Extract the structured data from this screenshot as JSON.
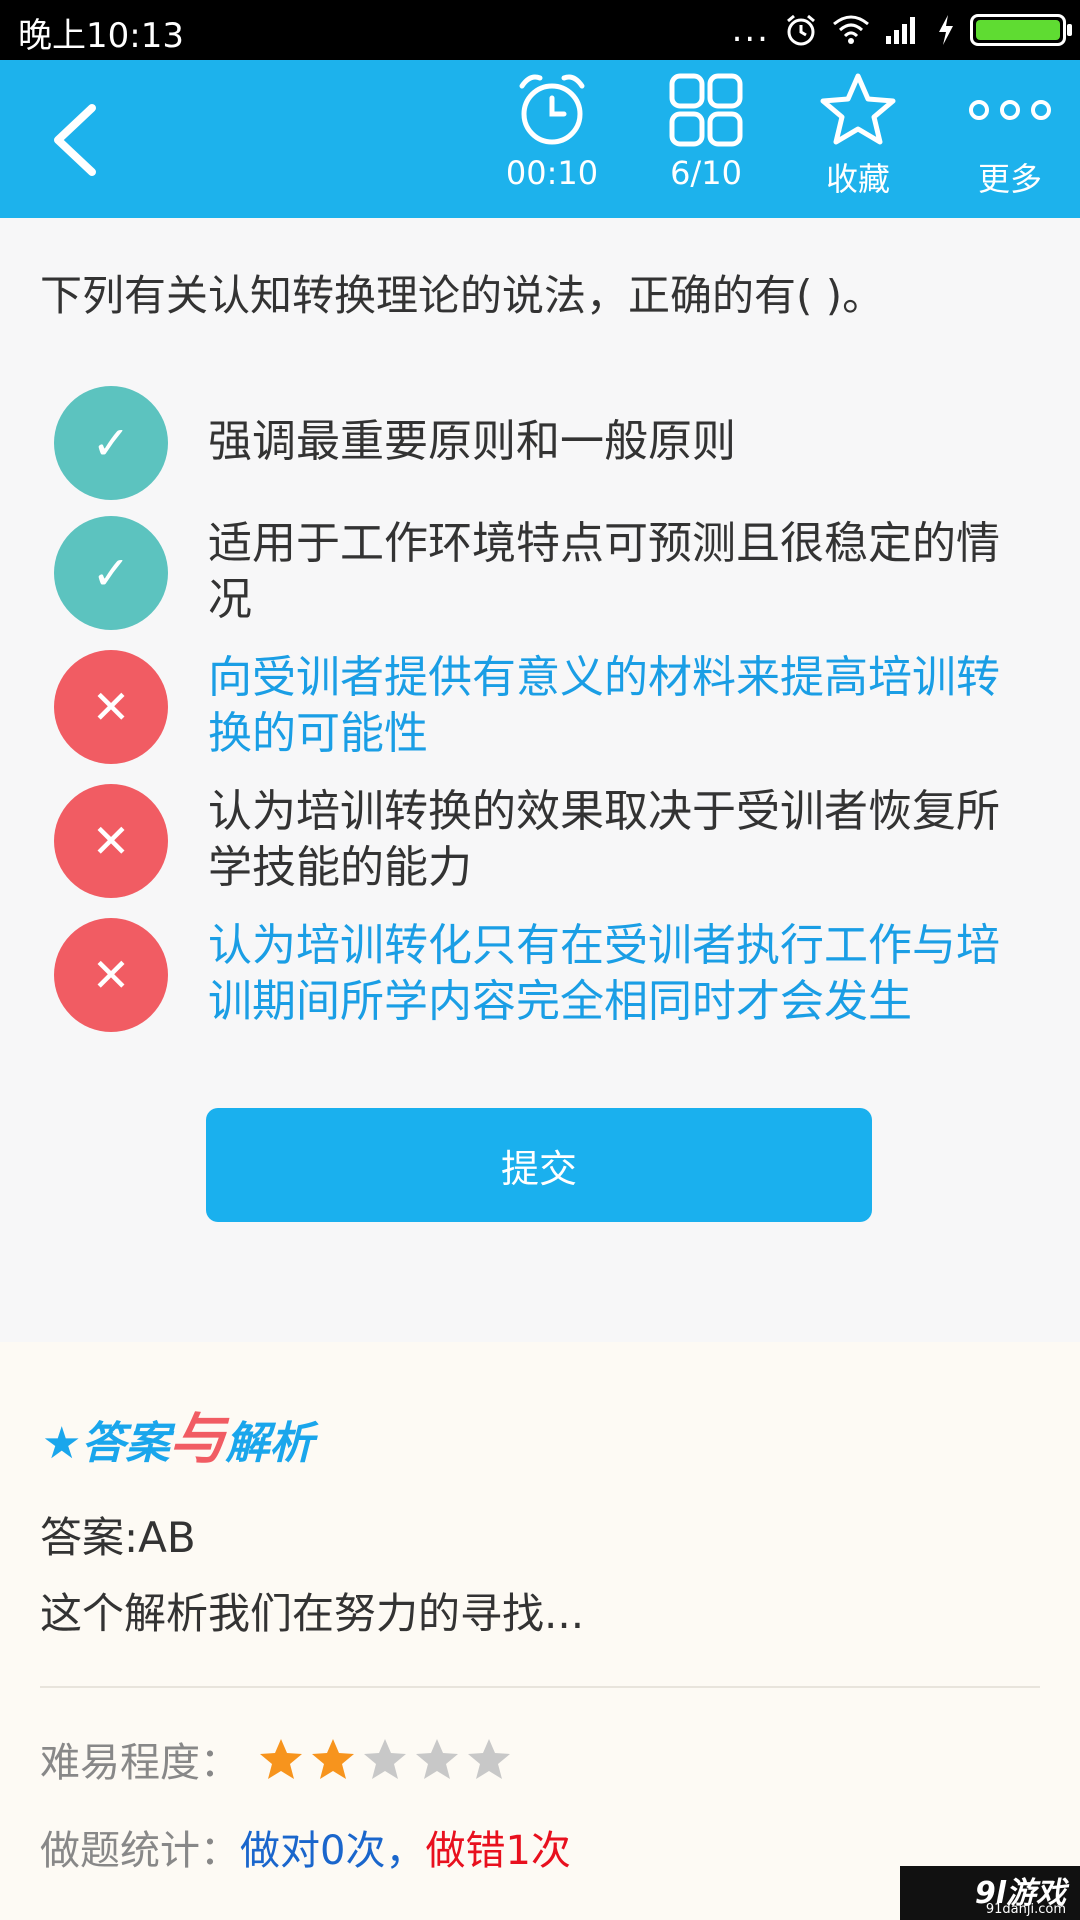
{
  "status_bar": {
    "time": "晚上10:13",
    "dots": "...",
    "icons": [
      "alarm-icon",
      "wifi-icon",
      "signal-icon",
      "charging-icon",
      "battery-icon"
    ],
    "battery_color": "#5fdc32"
  },
  "toolbar": {
    "timer": "00:10",
    "progress": "6/10",
    "favorite": "收藏",
    "more": "更多",
    "accent": "#1db2ec"
  },
  "question": {
    "text": "下列有关认知转换理论的说法，正确的有(    )。"
  },
  "options": [
    {
      "text": "强调最重要原则和一般原则",
      "status": "correct",
      "mark": "✓",
      "highlight": false
    },
    {
      "text": "适用于工作环境特点可预测且很稳定的情况",
      "status": "correct",
      "mark": "✓",
      "highlight": false
    },
    {
      "text": "向受训者提供有意义的材料来提高培训转换的可能性",
      "status": "wrong",
      "mark": "✕",
      "highlight": true
    },
    {
      "text": "认为培训转换的效果取决于受训者恢复所学技能的能力",
      "status": "wrong",
      "mark": "✕",
      "highlight": false
    },
    {
      "text": "认为培训转化只有在受训者执行工作与培训期间所学内容完全相同时才会发生",
      "status": "wrong",
      "mark": "✕",
      "highlight": true
    }
  ],
  "submit_label": "提交",
  "analysis": {
    "title_star": "★",
    "title_part1": "答案",
    "title_yu": "与",
    "title_part2": "解析",
    "answer": "答案:AB",
    "explanation": "这个解析我们在努力的寻找...",
    "difficulty_label": "难易程度：",
    "difficulty_rating": 2,
    "difficulty_max": 5,
    "stats_label": "做题统计：",
    "stats_correct": "做对0次",
    "stats_sep": "，",
    "stats_wrong": "做错1次"
  },
  "watermark": {
    "big": "9l游戏",
    "small": "91danji.com"
  }
}
